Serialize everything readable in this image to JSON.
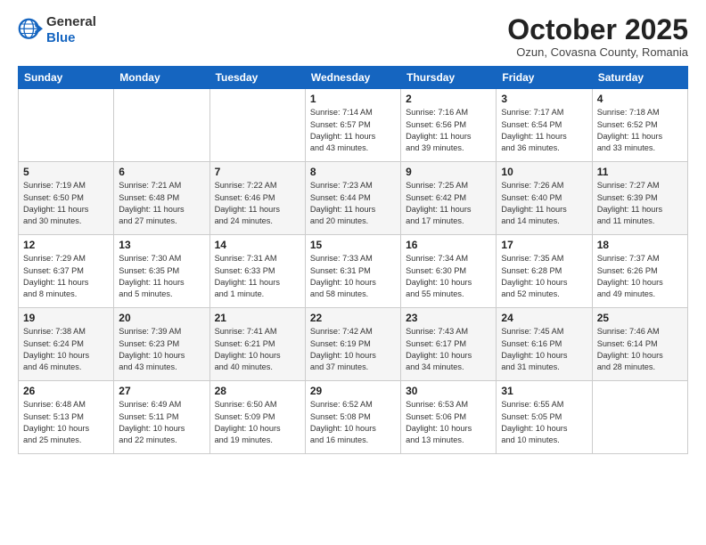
{
  "logo": {
    "general": "General",
    "blue": "Blue"
  },
  "header": {
    "month": "October 2025",
    "location": "Ozun, Covasna County, Romania"
  },
  "weekdays": [
    "Sunday",
    "Monday",
    "Tuesday",
    "Wednesday",
    "Thursday",
    "Friday",
    "Saturday"
  ],
  "weeks": [
    [
      {
        "day": "",
        "info": ""
      },
      {
        "day": "",
        "info": ""
      },
      {
        "day": "",
        "info": ""
      },
      {
        "day": "1",
        "info": "Sunrise: 7:14 AM\nSunset: 6:57 PM\nDaylight: 11 hours\nand 43 minutes."
      },
      {
        "day": "2",
        "info": "Sunrise: 7:16 AM\nSunset: 6:56 PM\nDaylight: 11 hours\nand 39 minutes."
      },
      {
        "day": "3",
        "info": "Sunrise: 7:17 AM\nSunset: 6:54 PM\nDaylight: 11 hours\nand 36 minutes."
      },
      {
        "day": "4",
        "info": "Sunrise: 7:18 AM\nSunset: 6:52 PM\nDaylight: 11 hours\nand 33 minutes."
      }
    ],
    [
      {
        "day": "5",
        "info": "Sunrise: 7:19 AM\nSunset: 6:50 PM\nDaylight: 11 hours\nand 30 minutes."
      },
      {
        "day": "6",
        "info": "Sunrise: 7:21 AM\nSunset: 6:48 PM\nDaylight: 11 hours\nand 27 minutes."
      },
      {
        "day": "7",
        "info": "Sunrise: 7:22 AM\nSunset: 6:46 PM\nDaylight: 11 hours\nand 24 minutes."
      },
      {
        "day": "8",
        "info": "Sunrise: 7:23 AM\nSunset: 6:44 PM\nDaylight: 11 hours\nand 20 minutes."
      },
      {
        "day": "9",
        "info": "Sunrise: 7:25 AM\nSunset: 6:42 PM\nDaylight: 11 hours\nand 17 minutes."
      },
      {
        "day": "10",
        "info": "Sunrise: 7:26 AM\nSunset: 6:40 PM\nDaylight: 11 hours\nand 14 minutes."
      },
      {
        "day": "11",
        "info": "Sunrise: 7:27 AM\nSunset: 6:39 PM\nDaylight: 11 hours\nand 11 minutes."
      }
    ],
    [
      {
        "day": "12",
        "info": "Sunrise: 7:29 AM\nSunset: 6:37 PM\nDaylight: 11 hours\nand 8 minutes."
      },
      {
        "day": "13",
        "info": "Sunrise: 7:30 AM\nSunset: 6:35 PM\nDaylight: 11 hours\nand 5 minutes."
      },
      {
        "day": "14",
        "info": "Sunrise: 7:31 AM\nSunset: 6:33 PM\nDaylight: 11 hours\nand 1 minute."
      },
      {
        "day": "15",
        "info": "Sunrise: 7:33 AM\nSunset: 6:31 PM\nDaylight: 10 hours\nand 58 minutes."
      },
      {
        "day": "16",
        "info": "Sunrise: 7:34 AM\nSunset: 6:30 PM\nDaylight: 10 hours\nand 55 minutes."
      },
      {
        "day": "17",
        "info": "Sunrise: 7:35 AM\nSunset: 6:28 PM\nDaylight: 10 hours\nand 52 minutes."
      },
      {
        "day": "18",
        "info": "Sunrise: 7:37 AM\nSunset: 6:26 PM\nDaylight: 10 hours\nand 49 minutes."
      }
    ],
    [
      {
        "day": "19",
        "info": "Sunrise: 7:38 AM\nSunset: 6:24 PM\nDaylight: 10 hours\nand 46 minutes."
      },
      {
        "day": "20",
        "info": "Sunrise: 7:39 AM\nSunset: 6:23 PM\nDaylight: 10 hours\nand 43 minutes."
      },
      {
        "day": "21",
        "info": "Sunrise: 7:41 AM\nSunset: 6:21 PM\nDaylight: 10 hours\nand 40 minutes."
      },
      {
        "day": "22",
        "info": "Sunrise: 7:42 AM\nSunset: 6:19 PM\nDaylight: 10 hours\nand 37 minutes."
      },
      {
        "day": "23",
        "info": "Sunrise: 7:43 AM\nSunset: 6:17 PM\nDaylight: 10 hours\nand 34 minutes."
      },
      {
        "day": "24",
        "info": "Sunrise: 7:45 AM\nSunset: 6:16 PM\nDaylight: 10 hours\nand 31 minutes."
      },
      {
        "day": "25",
        "info": "Sunrise: 7:46 AM\nSunset: 6:14 PM\nDaylight: 10 hours\nand 28 minutes."
      }
    ],
    [
      {
        "day": "26",
        "info": "Sunrise: 6:48 AM\nSunset: 5:13 PM\nDaylight: 10 hours\nand 25 minutes."
      },
      {
        "day": "27",
        "info": "Sunrise: 6:49 AM\nSunset: 5:11 PM\nDaylight: 10 hours\nand 22 minutes."
      },
      {
        "day": "28",
        "info": "Sunrise: 6:50 AM\nSunset: 5:09 PM\nDaylight: 10 hours\nand 19 minutes."
      },
      {
        "day": "29",
        "info": "Sunrise: 6:52 AM\nSunset: 5:08 PM\nDaylight: 10 hours\nand 16 minutes."
      },
      {
        "day": "30",
        "info": "Sunrise: 6:53 AM\nSunset: 5:06 PM\nDaylight: 10 hours\nand 13 minutes."
      },
      {
        "day": "31",
        "info": "Sunrise: 6:55 AM\nSunset: 5:05 PM\nDaylight: 10 hours\nand 10 minutes."
      },
      {
        "day": "",
        "info": ""
      }
    ]
  ]
}
